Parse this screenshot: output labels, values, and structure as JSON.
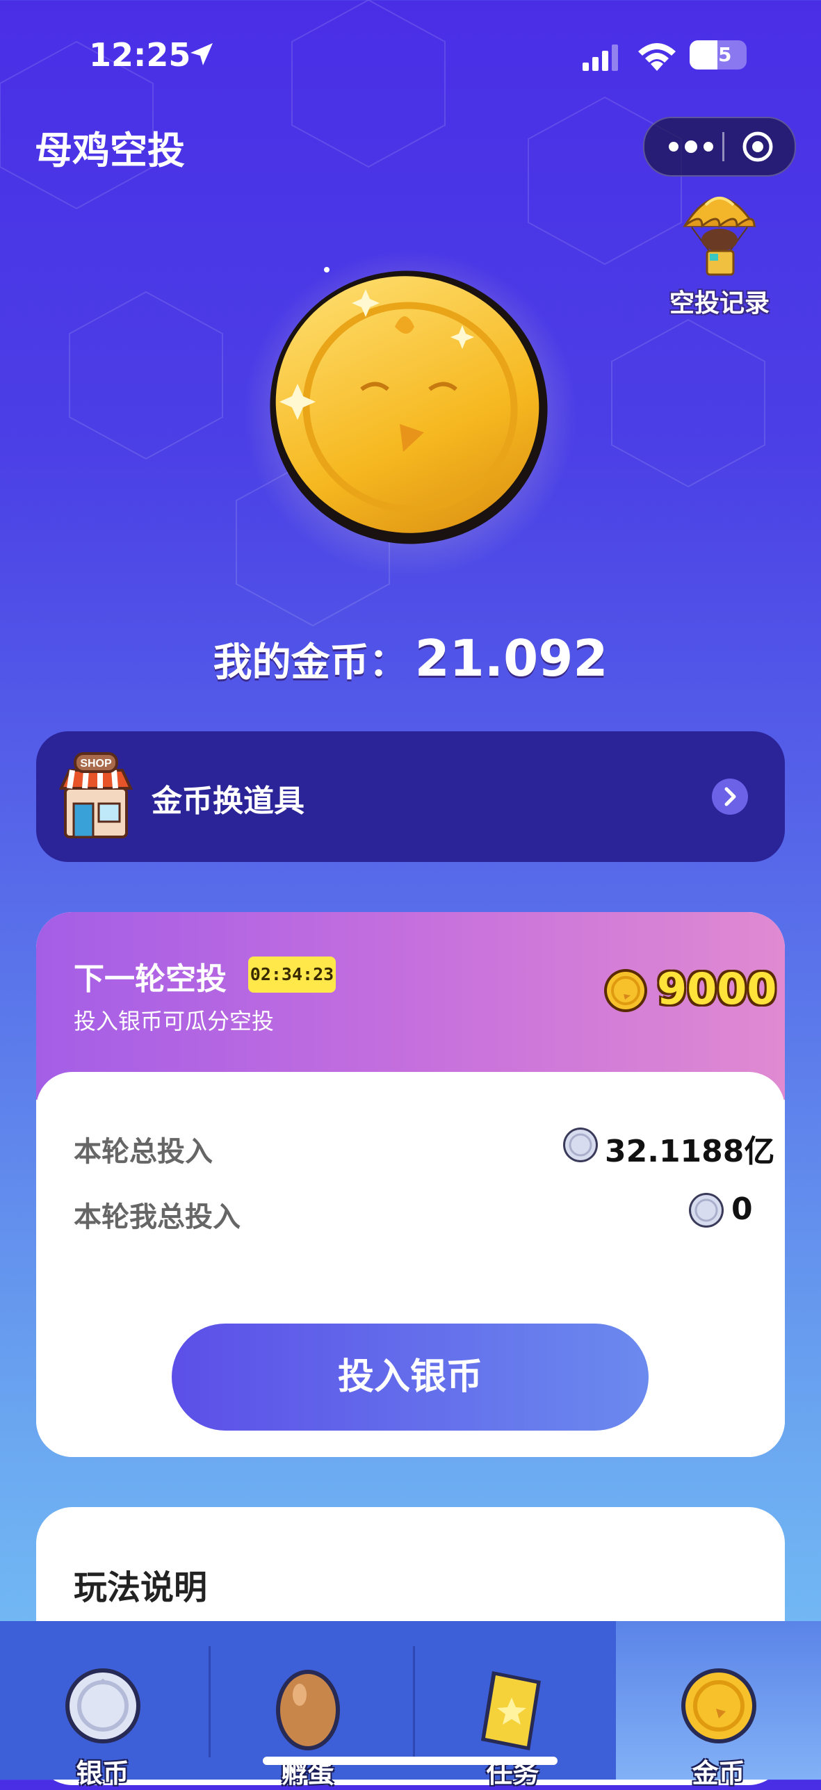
{
  "status_bar": {
    "time": "12:25",
    "battery": "25"
  },
  "nav": {
    "title": "母鸡空投"
  },
  "airdrop_record": {
    "label": "空投记录"
  },
  "balance": {
    "label": "我的金币：",
    "value": "21.092"
  },
  "shop": {
    "label": "金币换道具"
  },
  "next_round": {
    "title": "下一轮空投",
    "countdown": "02:34:23",
    "subtitle": "投入银币可瓜分空投",
    "prize": "9000",
    "total_label": "本轮总投入",
    "total_value": "32.1188亿",
    "my_label": "本轮我总投入",
    "my_value": "0",
    "button": "投入银币"
  },
  "rules": {
    "title": "玩法说明"
  },
  "tabs": [
    {
      "label": "银币",
      "icon": "silver-coin-icon"
    },
    {
      "label": "孵蛋",
      "icon": "egg-icon"
    },
    {
      "label": "任务",
      "icon": "ticket-star-icon"
    },
    {
      "label": "金币",
      "icon": "gold-coin-icon"
    }
  ],
  "colors": {
    "accent": "#5c4fe8",
    "gold": "#ffe23a",
    "shop_bg": "#2b2398",
    "tab_bg": "#3d5fd8"
  }
}
